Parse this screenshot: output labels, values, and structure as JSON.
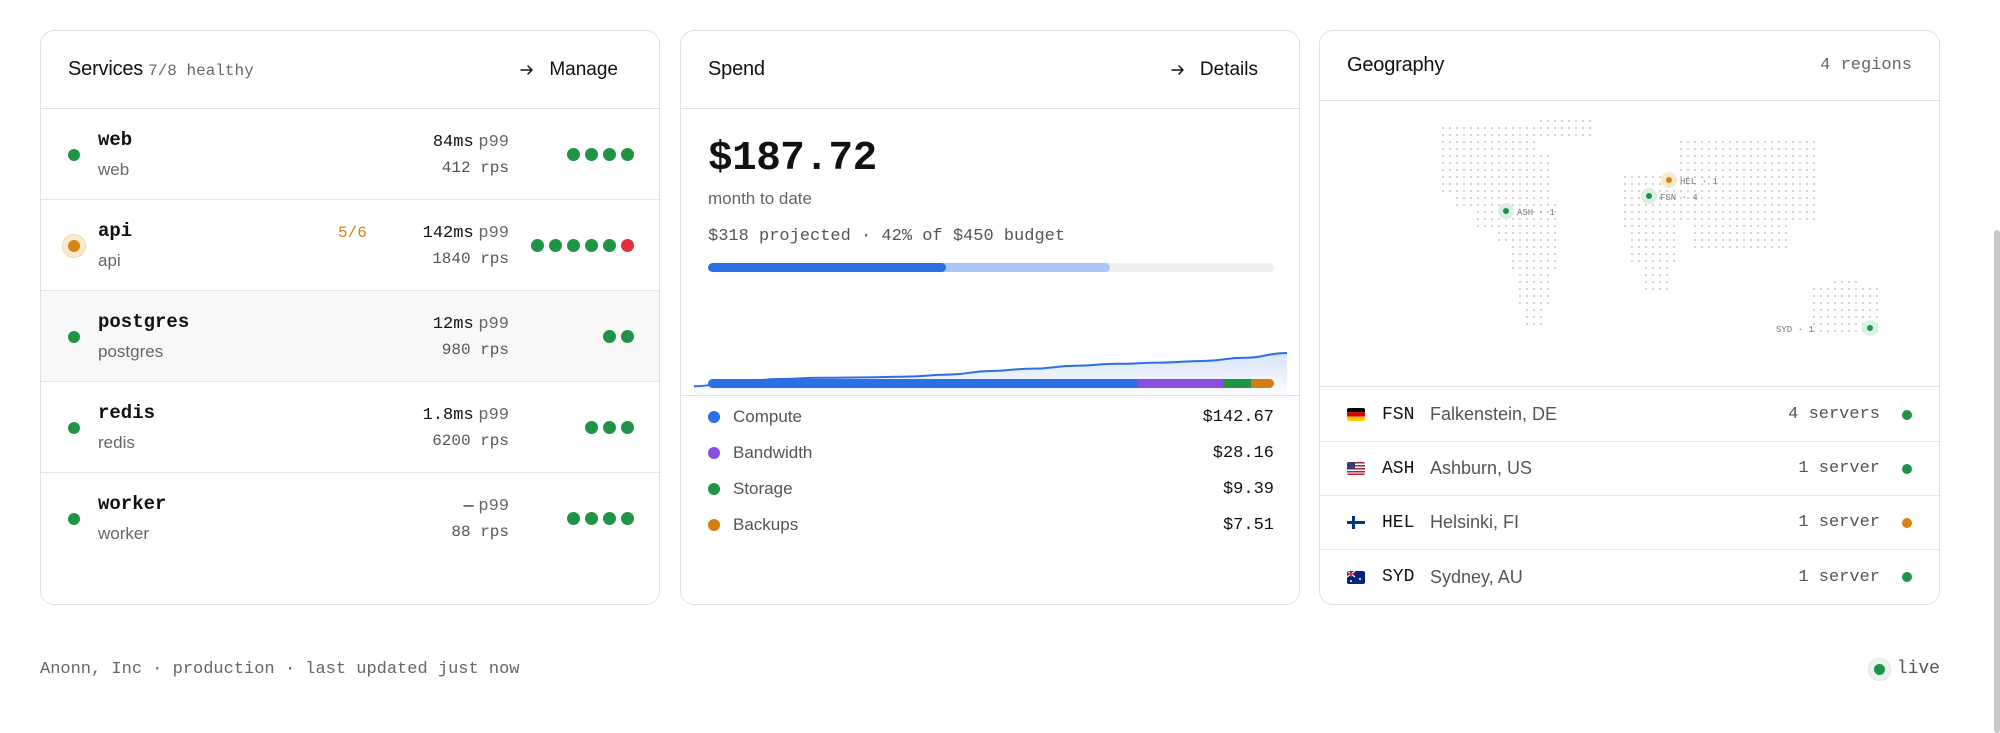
{
  "services": {
    "title": "Services",
    "health": "7/8 healthy",
    "manage_label": "Manage",
    "rows": [
      {
        "name": "web",
        "kind": "web",
        "ratio": "",
        "latency": "84ms",
        "latency_unit": "p99",
        "rps": "412 rps",
        "status": "ok",
        "pods": [
          "ok",
          "ok",
          "ok",
          "ok"
        ]
      },
      {
        "name": "api",
        "kind": "api",
        "ratio": "5/6",
        "latency": "142ms",
        "latency_unit": "p99",
        "rps": "1840 rps",
        "status": "warn",
        "pods": [
          "ok",
          "ok",
          "ok",
          "ok",
          "ok",
          "bad"
        ]
      },
      {
        "name": "postgres",
        "kind": "postgres",
        "ratio": "",
        "latency": "12ms",
        "latency_unit": "p99",
        "rps": "980 rps",
        "status": "ok",
        "pods": [
          "ok",
          "ok"
        ]
      },
      {
        "name": "redis",
        "kind": "redis",
        "ratio": "",
        "latency": "1.8ms",
        "latency_unit": "p99",
        "rps": "6200 rps",
        "status": "ok",
        "pods": [
          "ok",
          "ok",
          "ok"
        ]
      },
      {
        "name": "worker",
        "kind": "worker",
        "ratio": "",
        "latency": "—",
        "latency_unit": "p99",
        "rps": "88 rps",
        "status": "ok",
        "pods": [
          "ok",
          "ok",
          "ok",
          "ok"
        ]
      }
    ]
  },
  "spend": {
    "title": "Spend",
    "details_label": "Details",
    "amount": "$187.72",
    "period": "month to date",
    "projection": "$318 projected · 42% of $450 budget",
    "current_fraction": 0.42,
    "projected_fraction": 0.71,
    "trend": [
      0.12,
      0.22,
      0.3,
      0.33,
      0.34,
      0.36,
      0.41,
      0.5,
      0.56,
      0.63,
      0.68,
      0.71,
      0.75,
      0.83,
      0.95
    ],
    "breakdown": [
      {
        "label": "Compute",
        "value": "$142.67",
        "amount": 142.67,
        "color": "#2b6fe5"
      },
      {
        "label": "Bandwidth",
        "value": "$28.16",
        "amount": 28.16,
        "color": "#8a4fe0"
      },
      {
        "label": "Storage",
        "value": "$9.39",
        "amount": 9.39,
        "color": "#1f9447"
      },
      {
        "label": "Backups",
        "value": "$7.51",
        "amount": 7.51,
        "color": "#d17f12"
      }
    ]
  },
  "geography": {
    "title": "Geography",
    "count": "4 regions",
    "map_markers": [
      {
        "label": "ASH · 1",
        "status": "ok"
      },
      {
        "label": "FSN · 4",
        "status": "ok"
      },
      {
        "label": "HEL · 1",
        "status": "warn"
      },
      {
        "label": "SYD · 1",
        "status": "ok"
      }
    ],
    "regions": [
      {
        "flag": "de",
        "code": "FSN",
        "city": "Falkenstein, DE",
        "servers": "4 servers",
        "status": "ok"
      },
      {
        "flag": "us",
        "code": "ASH",
        "city": "Ashburn, US",
        "servers": "1 server",
        "status": "ok"
      },
      {
        "flag": "fi",
        "code": "HEL",
        "city": "Helsinki, FI",
        "servers": "1 server",
        "status": "warn"
      },
      {
        "flag": "au",
        "code": "SYD",
        "city": "Sydney, AU",
        "servers": "1 server",
        "status": "ok"
      }
    ]
  },
  "footer": {
    "meta": "Anonn, Inc · production · last updated just now",
    "live": "live"
  },
  "colors": {
    "ok": "#1f9447",
    "warn": "#d98312",
    "bad": "#e0303b",
    "accent": "#2b6fe5"
  }
}
